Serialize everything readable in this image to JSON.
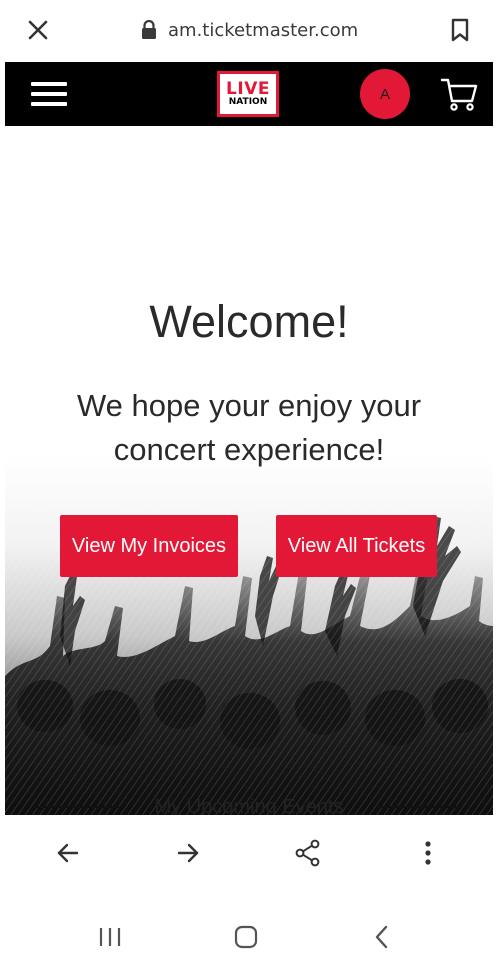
{
  "browser": {
    "url": "am.ticketmaster.com"
  },
  "header": {
    "logo_top": "LIVE",
    "logo_bottom": "NATION",
    "avatar_initial": "A",
    "brand_color": "#e31837"
  },
  "main": {
    "title": "Welcome!",
    "subtitle": "We hope your enjoy your concert experience!",
    "buttons": {
      "invoices_label": "View My Invoices",
      "tickets_label": "View All Tickets"
    },
    "section_heading": "My Upcoming Events"
  },
  "icons": {
    "close": "close-icon",
    "lock": "lock-icon",
    "bookmark": "bookmark-icon",
    "menu": "hamburger-menu-icon",
    "cart": "cart-icon",
    "back": "arrow-left-icon",
    "forward": "arrow-right-icon",
    "share": "share-icon",
    "more": "more-vertical-icon",
    "recents": "recent-apps-icon",
    "home": "home-icon",
    "nav_back": "chevron-left-icon"
  }
}
